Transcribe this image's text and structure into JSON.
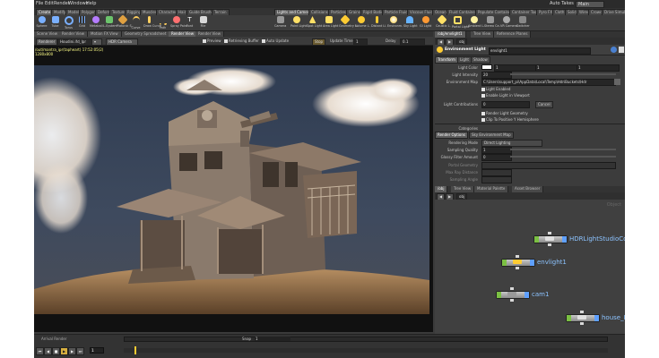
{
  "menubar": {
    "items": [
      "File",
      "Edit",
      "Render",
      "Windows",
      "Help"
    ],
    "desktop_label": "Auto Takes",
    "context": "Main"
  },
  "shelf_tabs": [
    "Create",
    "Modify",
    "Model",
    "Polygon",
    "Deform",
    "Texture",
    "Rigging",
    "Muscles",
    "Characters",
    "Hair",
    "Guide Brushes",
    "Terrain"
  ],
  "shelf_tabs_right": [
    "Lights and Cameras",
    "Collisions",
    "Particles",
    "Grains",
    "Rigid Bodies",
    "Particle Fluids",
    "Viscous Fluids",
    "Oceans",
    "Fluid Containers",
    "Populate Containers",
    "Container Tools",
    "Pyro FX",
    "Cloth",
    "Solid",
    "Wires",
    "Crowds",
    "Drive Simulation"
  ],
  "tools_left": [
    "Sphere",
    "Tube",
    "Torus",
    "Grid",
    "Metaball",
    "L-System",
    "Platonic S.",
    "Curve",
    "Draw Curve",
    "Path",
    "Spray Paint",
    "Font",
    "File"
  ],
  "tools_right": [
    "Camera",
    "Point Light",
    "Spot Light",
    "Area Light",
    "Geometry L.",
    "Volume L.",
    "Distant Li.",
    "Environm.",
    "Sky Light",
    "GI Light",
    "Caustic L.",
    "Portal Light",
    "Ambient L.",
    "Stereo Ca.",
    "VR Camera",
    "Switcher"
  ],
  "viewer": {
    "tabs": [
      "Scene View",
      "Render View",
      "Motion FX View",
      "Geometry Spreadsheet",
      "Render View",
      "Render View"
    ],
    "renderer": "Renderer",
    "renderer_value": "Houdini.ifd_Ipr",
    "camera": "HDR Camera",
    "preview_label": "Preview",
    "render_buffer_label": "Retrieving Buffer",
    "auto_update_label": "Auto Update",
    "stop_label": "Stop",
    "update_label": "Update Time",
    "update_value": "1",
    "delay_label": "Delay",
    "delay_value": "0.1",
    "info_line1": "/out/mantra_ipr(tapheart) 17:52:05(2)",
    "info_line2": "1280x800"
  },
  "right_panel": {
    "tabs": [
      "/obj/envlight1",
      "Tree View",
      "Reference Planes"
    ],
    "path": "obj",
    "node_type": "Environment Light",
    "node_name": "envlight1",
    "param_tabs": [
      "Transform",
      "Light",
      "Shadow"
    ],
    "light_color_label": "Light Color",
    "light_color_values": [
      "1",
      "1",
      "1"
    ],
    "light_intensity_label": "Light Intensity",
    "light_intensity_value": "20",
    "env_map_label": "Environment Map",
    "env_map_value": "C:\\Users\\support_pi\\AppData\\Local\\Temp\\HdriBuckets\\Hdr",
    "light_enabled": "Light Enabled",
    "enable_in_viewport": "Enable Light in Viewport",
    "light_contrib_label": "Light Contributions",
    "light_contrib_value": "0",
    "light_contrib_btn": "Cancel",
    "render_light_geo": "Render Light Geometry",
    "clip_hemisphere": "Clip To Positive Y Hemisphere",
    "categories_label": "Categories",
    "sub_tabs": [
      "Render Options",
      "Sky Environment Map"
    ],
    "rendering_mode_label": "Rendering Mode",
    "rendering_mode_value": "Direct Lighting",
    "sampling_quality_label": "Sampling Quality",
    "sampling_quality_value": "1",
    "glossy_filter_label": "Glossy Filter Amount",
    "glossy_filter_value": "0",
    "portal_geo_label": "Portal Geometry",
    "max_ray_label": "Max Ray Distance",
    "sampling_angle_label": "Sampling Angle"
  },
  "network": {
    "tabs": [
      "/obj",
      "Tree View",
      "Material Palette",
      "Asset Browser"
    ],
    "path": "obj",
    "context_label": "Object",
    "nodes": [
      {
        "name": "HDRLightStudioController1"
      },
      {
        "name": "envlight1"
      },
      {
        "name": "cam1"
      },
      {
        "name": "house_FBX"
      }
    ]
  },
  "timeline": {
    "frame_value": "1",
    "snap_label": "Snap",
    "snap_value": "1",
    "render_label": "Arrival Render"
  },
  "colors": {
    "accent_blue": "#8cc3ff",
    "node_green": "#7bc043",
    "panel_bg": "#3a3a3a"
  }
}
